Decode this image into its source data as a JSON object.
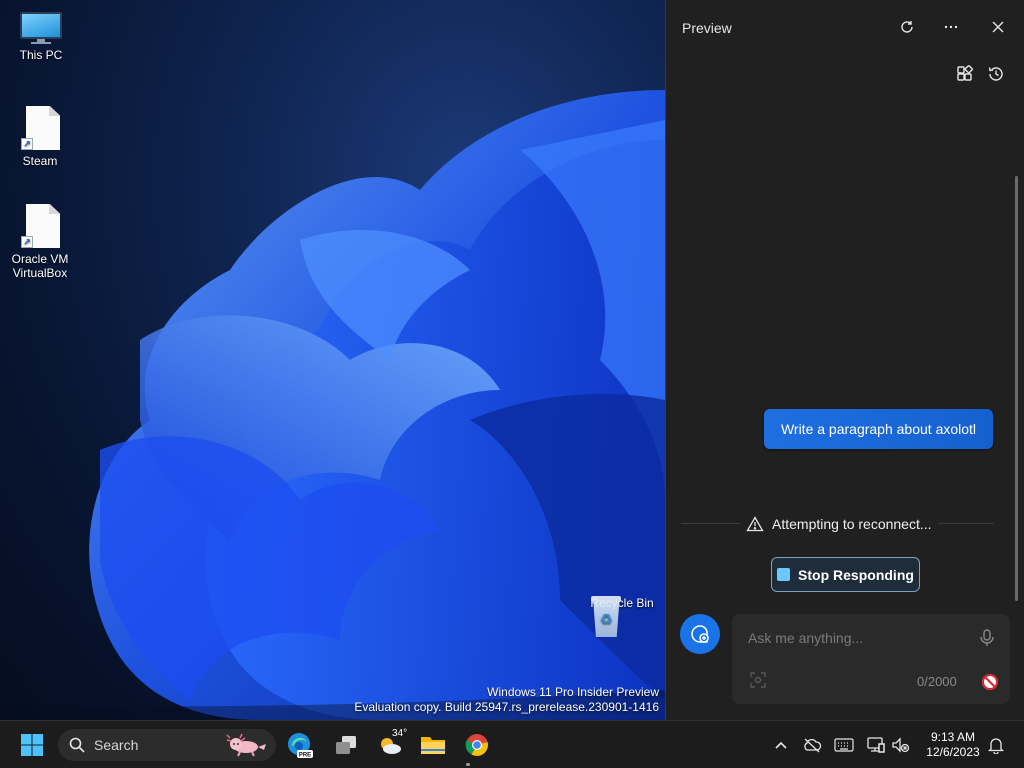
{
  "desktop": {
    "icons": [
      {
        "label": "This PC",
        "icon": "monitor-icon"
      },
      {
        "label": "Steam",
        "icon": "document-shortcut-icon"
      },
      {
        "label_line1": "Oracle VM",
        "label_line2": "VirtualBox",
        "icon": "document-shortcut-icon"
      },
      {
        "label": "Recycle Bin",
        "icon": "recycle-bin-icon"
      }
    ],
    "watermark": {
      "line1": "Windows 11 Pro Insider Preview",
      "line2": "Evaluation copy. Build 25947.rs_prerelease.230901-1416"
    }
  },
  "panel": {
    "title": "Preview",
    "header_icons": [
      "refresh-icon",
      "more-icon",
      "close-icon"
    ],
    "tool_icons": [
      "plugins-icon",
      "history-icon"
    ],
    "user_message": "Write a paragraph about axolotl",
    "status_text": "Attempting to reconnect...",
    "stop_label": "Stop Responding",
    "input": {
      "placeholder": "Ask me anything...",
      "counter": "0/2000"
    }
  },
  "taskbar": {
    "search_label": "Search",
    "weather_temp": "34°",
    "clock_time": "9:13 AM",
    "clock_date": "12/6/2023",
    "apps": [
      "start-icon",
      "edge-pre-icon",
      "task-view-icon",
      "weather-icon",
      "file-explorer-icon",
      "chrome-icon"
    ]
  },
  "colors": {
    "accent": "#1a74e8",
    "panel_bg": "#202020",
    "taskbar_bg": "#1c1c1c"
  }
}
